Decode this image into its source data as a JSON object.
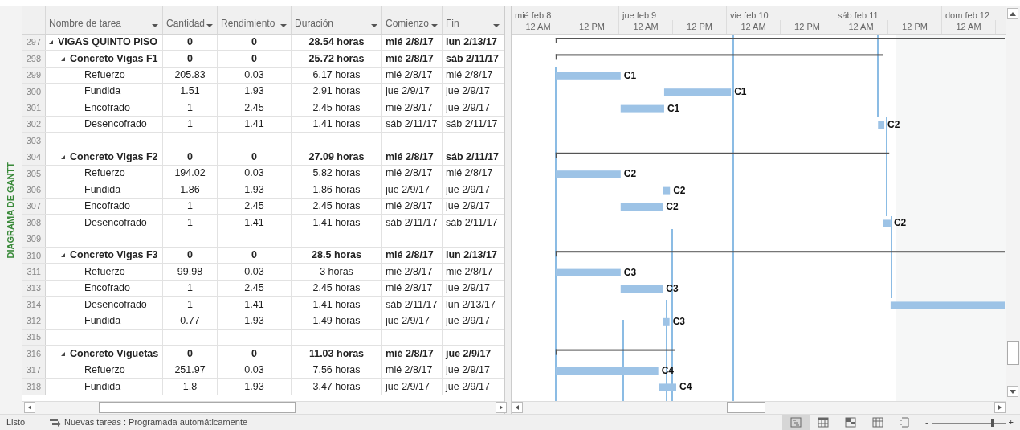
{
  "side_label": "DIAGRAMA DE GANTT",
  "columns": [
    "Nombre de tarea",
    "Cantidad",
    "Rendimiento",
    "Duración",
    "Comienzo",
    "Fin"
  ],
  "timescale": {
    "days": [
      "mié feb 8",
      "jue feb 9",
      "vie feb 10",
      "sáb feb 11",
      "dom feb 12"
    ],
    "hours": [
      "12 AM",
      "12 PM",
      "12 AM",
      "12 PM",
      "12 AM",
      "12 PM",
      "12 AM",
      "12 PM",
      "12 AM"
    ]
  },
  "tasks": [
    {
      "id": "297",
      "name": "VIGAS QUINTO PISO",
      "cantidad": "0",
      "rendimiento": "0",
      "duracion": "28.54 horas",
      "comienzo": "mié 2/8/17",
      "fin": "lun 2/13/17",
      "expanded": true,
      "children": [
        {
          "id": "298",
          "name": "Concreto Vigas F1",
          "cantidad": "0",
          "rendimiento": "0",
          "duracion": "25.72 horas",
          "comienzo": "mié 2/8/17",
          "fin": "sáb 2/11/17",
          "expanded": true,
          "children": [
            {
              "id": "299",
              "name": "Refuerzo",
              "cantidad": "205.83",
              "rendimiento": "0.03",
              "duracion": "6.17 horas",
              "comienzo": "mié 2/8/17",
              "fin": "mié 2/8/17",
              "bar": {
                "label": "C1"
              }
            },
            {
              "id": "300",
              "name": "Fundida",
              "cantidad": "1.51",
              "rendimiento": "1.93",
              "duracion": "2.91 horas",
              "comienzo": "jue 2/9/17",
              "fin": "jue 2/9/17",
              "bar": {
                "label": "C1"
              }
            },
            {
              "id": "301",
              "name": "Encofrado",
              "cantidad": "1",
              "rendimiento": "2.45",
              "duracion": "2.45 horas",
              "comienzo": "mié 2/8/17",
              "fin": "jue 2/9/17",
              "bar": {
                "label": "C1"
              }
            },
            {
              "id": "302",
              "name": "Desencofrado",
              "cantidad": "1",
              "rendimiento": "1.41",
              "duracion": "1.41 horas",
              "comienzo": "sáb 2/11/17",
              "fin": "sáb 2/11/17",
              "bar": {
                "label": "C2"
              }
            }
          ]
        },
        {
          "id": "303"
        },
        {
          "id": "304",
          "name": "Concreto Vigas F2",
          "cantidad": "0",
          "rendimiento": "0",
          "duracion": "27.09 horas",
          "comienzo": "mié 2/8/17",
          "fin": "sáb 2/11/17",
          "expanded": true,
          "children": [
            {
              "id": "305",
              "name": "Refuerzo",
              "cantidad": "194.02",
              "rendimiento": "0.03",
              "duracion": "5.82 horas",
              "comienzo": "mié 2/8/17",
              "fin": "mié 2/8/17",
              "bar": {
                "label": "C2"
              }
            },
            {
              "id": "306",
              "name": "Fundida",
              "cantidad": "1.86",
              "rendimiento": "1.93",
              "duracion": "1.86 horas",
              "comienzo": "jue 2/9/17",
              "fin": "jue 2/9/17",
              "bar": {
                "label": "C2"
              }
            },
            {
              "id": "307",
              "name": "Encofrado",
              "cantidad": "1",
              "rendimiento": "2.45",
              "duracion": "2.45 horas",
              "comienzo": "mié 2/8/17",
              "fin": "jue 2/9/17",
              "bar": {
                "label": "C2"
              }
            },
            {
              "id": "308",
              "name": "Desencofrado",
              "cantidad": "1",
              "rendimiento": "1.41",
              "duracion": "1.41 horas",
              "comienzo": "sáb 2/11/17",
              "fin": "sáb 2/11/17",
              "bar": {
                "label": "C2"
              }
            }
          ]
        },
        {
          "id": "309"
        },
        {
          "id": "310",
          "name": "Concreto Vigas F3",
          "cantidad": "0",
          "rendimiento": "0",
          "duracion": "28.5 horas",
          "comienzo": "mié 2/8/17",
          "fin": "lun 2/13/17",
          "expanded": true,
          "children": [
            {
              "id": "311",
              "name": "Refuerzo",
              "cantidad": "99.98",
              "rendimiento": "0.03",
              "duracion": "3 horas",
              "comienzo": "mié 2/8/17",
              "fin": "mié 2/8/17",
              "bar": {
                "label": "C3"
              }
            },
            {
              "id": "313",
              "name": "Encofrado",
              "cantidad": "1",
              "rendimiento": "2.45",
              "duracion": "2.45 horas",
              "comienzo": "mié 2/8/17",
              "fin": "jue 2/9/17",
              "bar": {
                "label": "C3"
              }
            },
            {
              "id": "314",
              "name": "Desencofrado",
              "cantidad": "1",
              "rendimiento": "1.41",
              "duracion": "1.41 horas",
              "comienzo": "sáb 2/11/17",
              "fin": "lun 2/13/17"
            },
            {
              "id": "312",
              "name": "Fundida",
              "cantidad": "0.77",
              "rendimiento": "1.93",
              "duracion": "1.49 horas",
              "comienzo": "jue 2/9/17",
              "fin": "jue 2/9/17",
              "bar": {
                "label": "C3"
              }
            }
          ]
        },
        {
          "id": "315"
        },
        {
          "id": "316",
          "name": "Concreto Viguetas",
          "cantidad": "0",
          "rendimiento": "0",
          "duracion": "11.03 horas",
          "comienzo": "mié 2/8/17",
          "fin": "jue 2/9/17",
          "expanded": true,
          "children": [
            {
              "id": "317",
              "name": "Refuerzo",
              "cantidad": "251.97",
              "rendimiento": "0.03",
              "duracion": "7.56 horas",
              "comienzo": "mié 2/8/17",
              "fin": "jue 2/9/17",
              "bar": {
                "label": "C4"
              }
            },
            {
              "id": "318",
              "name": "Fundida",
              "cantidad": "1.8",
              "rendimiento": "1.93",
              "duracion": "3.47 horas",
              "comienzo": "jue 2/9/17",
              "fin": "jue 2/9/17",
              "bar": {
                "label": "C4"
              }
            }
          ]
        }
      ]
    }
  ],
  "status_bar": {
    "ready": "Listo",
    "new_tasks": "Nuevas tareas : Programada automáticamente",
    "views": [
      {
        "kind": "gantt",
        "selected": true
      },
      {
        "kind": "calendar",
        "selected": false
      },
      {
        "kind": "planner",
        "selected": false
      },
      {
        "kind": "sheet",
        "selected": false
      },
      {
        "kind": "report",
        "selected": false
      }
    ],
    "zoom": {
      "minus": "-",
      "plus": "+",
      "level": 0.85
    }
  }
}
